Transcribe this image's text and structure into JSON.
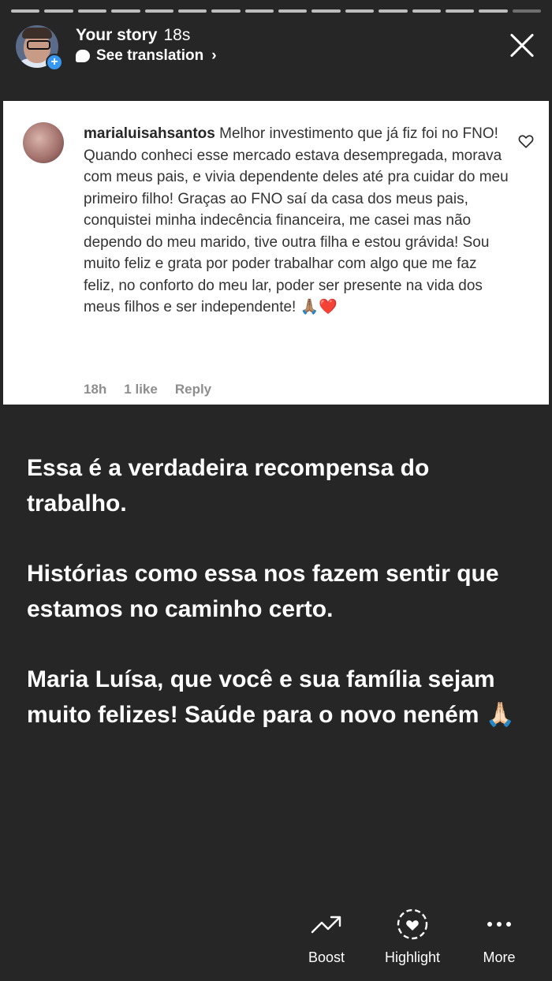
{
  "progress": {
    "segments": 16,
    "current_index": 15
  },
  "header": {
    "title": "Your story",
    "time": "18s",
    "translate": "See translation",
    "chevron": "›"
  },
  "comment": {
    "username": "marialuisahsantos",
    "text": "Melhor investimento que já fiz foi no FNO! Quando conheci esse mercado estava desempregada, morava com meus pais, e vivia dependente deles até pra cuidar do meu primeiro filho! Graças ao FNO saí da casa dos meus pais, conquistei minha indecência financeira, me casei mas não dependo do meu marido, tive outra filha e estou grávida! Sou muito feliz e grata por poder trabalhar com algo que me faz feliz, no conforto do meu lar, poder ser presente na vida dos meus filhos e ser independente! 🙏🏽❤️",
    "time": "18h",
    "likes": "1 like",
    "reply": "Reply"
  },
  "story_text": {
    "p1": "Essa é a verdadeira recompensa do trabalho.",
    "p2": "Histórias como essa nos fazem sentir que estamos no caminho certo.",
    "p3": "Maria Luísa, que você e sua família sejam muito felizes! Saúde para o novo neném 🙏🏻"
  },
  "actions": {
    "boost": "Boost",
    "highlight": "Highlight",
    "more": "More"
  },
  "icons": {
    "close": "close-icon",
    "boost": "trending-up-icon",
    "highlight": "heart-circle-icon",
    "more": "more-dots-icon"
  }
}
